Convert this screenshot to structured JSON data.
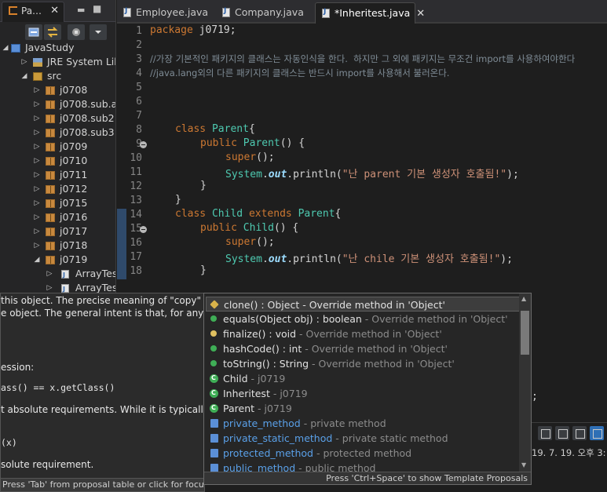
{
  "left_panel": {
    "tab_label": "Pa…",
    "tab_icon": "package-explorer-icon",
    "tree": [
      {
        "label": "JavaStudy",
        "depth": 0,
        "expanded": true,
        "icon": "project-icon"
      },
      {
        "label": "JRE System Lib",
        "depth": 1,
        "expanded": false,
        "icon": "library-icon"
      },
      {
        "label": "src",
        "depth": 1,
        "expanded": true,
        "icon": "source-folder-icon"
      },
      {
        "label": "j0708",
        "depth": 2,
        "expanded": false,
        "icon": "package-icon"
      },
      {
        "label": "j0708.sub.a",
        "depth": 2,
        "expanded": false,
        "icon": "package-icon"
      },
      {
        "label": "j0708.sub2",
        "depth": 2,
        "expanded": false,
        "icon": "package-icon"
      },
      {
        "label": "j0708.sub3",
        "depth": 2,
        "expanded": false,
        "icon": "package-icon"
      },
      {
        "label": "j0709",
        "depth": 2,
        "expanded": false,
        "icon": "package-icon"
      },
      {
        "label": "j0710",
        "depth": 2,
        "expanded": false,
        "icon": "package-icon"
      },
      {
        "label": "j0711",
        "depth": 2,
        "expanded": false,
        "icon": "package-icon"
      },
      {
        "label": "j0712",
        "depth": 2,
        "expanded": false,
        "icon": "package-icon"
      },
      {
        "label": "j0715",
        "depth": 2,
        "expanded": false,
        "icon": "package-icon"
      },
      {
        "label": "j0716",
        "depth": 2,
        "expanded": false,
        "icon": "package-icon"
      },
      {
        "label": "j0717",
        "depth": 2,
        "expanded": false,
        "icon": "package-icon"
      },
      {
        "label": "j0718",
        "depth": 2,
        "expanded": false,
        "icon": "package-icon"
      },
      {
        "label": "j0719",
        "depth": 2,
        "expanded": true,
        "icon": "package-icon"
      },
      {
        "label": "ArrayTes",
        "depth": 3,
        "expanded": false,
        "icon": "java-file-icon"
      },
      {
        "label": "ArrayTes",
        "depth": 3,
        "expanded": false,
        "icon": "java-file-icon"
      }
    ]
  },
  "editor_tabs": [
    {
      "label": "Employee.java",
      "active": false
    },
    {
      "label": "Company.java",
      "active": false
    },
    {
      "label": "*Inheritest.java",
      "active": true
    }
  ],
  "line_numbers": [
    "1",
    "2",
    "3",
    "4",
    "5",
    "6",
    "7",
    "8",
    "9",
    "10",
    "11",
    "12",
    "13",
    "14",
    "15",
    "16",
    "17",
    "18"
  ],
  "code": {
    "l1_kw": "package",
    "l1_rest": " j0719;",
    "l3": "//가장 기본적인 패키지의 클래스는 자동인식을 한다.  하지만 그 외에 패키지는 무조건 import를 사용하여야한다",
    "l4": "//java.lang외의 다른 패키지의 클래스는 반드시 import를 사용해서 불러온다.",
    "l8_kw": "class",
    "l8_type": "Parent",
    "l8_rest": "{",
    "l9_kw": "public",
    "l9_type": "Parent",
    "l9_rest": "() {",
    "l10_kw": "super",
    "l10_rest": "();",
    "l11_sys": "System",
    "l11_dot": ".",
    "l11_out": "out",
    "l11_call": ".println(",
    "l11_str": "\"난 parent 기본 생성자 호출됨!\"",
    "l11_end": ");",
    "l12": "}",
    "l13": "}",
    "l14_kw": "class",
    "l14_type": "Child",
    "l14_ext": "extends",
    "l14_type2": "Parent",
    "l14_rest": "{",
    "l15_kw": "public",
    "l15_type": "Child",
    "l15_rest": "() {",
    "l16_kw": "super",
    "l16_rest": "();",
    "l17_sys": "System",
    "l17_dot": ".",
    "l17_out": "out",
    "l17_call": ".println(",
    "l17_str": "\"난 chile 기본 생성자 호출됨!\"",
    "l17_end": ");",
    "l18": "}",
    "partial_semicolon": ";"
  },
  "doc_tooltip": {
    "lines": [
      "this object. The precise meaning of \"copy\"",
      "e object. The general intent is that, for any",
      "ession:",
      "ass() == x.getClass()",
      "t absolute requirements. While it is typically",
      "(x)",
      "solute requirement."
    ],
    "status": "Press 'Tab' from proposal table or click for focus"
  },
  "content_assist": {
    "proposals": [
      {
        "main": "clone() : Object",
        "sep": " - ",
        "detail": "Override method in 'Object'",
        "icon": "override-method-icon",
        "selected": true,
        "main_style": "normal"
      },
      {
        "main": "equals(Object obj) : boolean",
        "sep": " - ",
        "detail": "Override method in 'Object'",
        "icon": "public-method-icon",
        "selected": false,
        "main_style": "normal"
      },
      {
        "main": "finalize() : void",
        "sep": " - ",
        "detail": "Override method in 'Object'",
        "icon": "finalize-method-icon",
        "selected": false,
        "main_style": "normal"
      },
      {
        "main": "hashCode() : int",
        "sep": " - ",
        "detail": "Override method in 'Object'",
        "icon": "public-method-icon",
        "selected": false,
        "main_style": "normal"
      },
      {
        "main": "toString() : String",
        "sep": " - ",
        "detail": "Override method in 'Object'",
        "icon": "public-method-icon",
        "selected": false,
        "main_style": "normal"
      },
      {
        "main": "Child",
        "sep": " - ",
        "detail": "j0719",
        "icon": "class-icon",
        "selected": false,
        "main_style": "normal"
      },
      {
        "main": "Inheritest",
        "sep": " - ",
        "detail": "j0719",
        "icon": "class-icon",
        "selected": false,
        "main_style": "normal"
      },
      {
        "main": "Parent",
        "sep": " - ",
        "detail": "j0719",
        "icon": "class-icon",
        "selected": false,
        "main_style": "normal"
      },
      {
        "main": "private_method",
        "sep": " - ",
        "detail": "private method",
        "icon": "template-icon",
        "selected": false,
        "main_style": "link"
      },
      {
        "main": "private_static_method",
        "sep": " - ",
        "detail": "private static method",
        "icon": "template-icon",
        "selected": false,
        "main_style": "link"
      },
      {
        "main": "protected_method",
        "sep": " - ",
        "detail": "protected method",
        "icon": "template-icon",
        "selected": false,
        "main_style": "link"
      },
      {
        "main": "public_method",
        "sep": " - ",
        "detail": "public method",
        "icon": "template-icon",
        "selected": false,
        "main_style": "link"
      }
    ],
    "status": "Press 'Ctrl+Space' to show Template Proposals"
  },
  "console": {
    "date_text": "19. 7. 19. 오후 3:"
  },
  "colors": {
    "background": "#1e1e1e",
    "keyword": "#cc7832",
    "type": "#4ec9b0",
    "comment": "#7f8c96",
    "string": "#ce9178",
    "template_link": "#5aa0e8"
  }
}
